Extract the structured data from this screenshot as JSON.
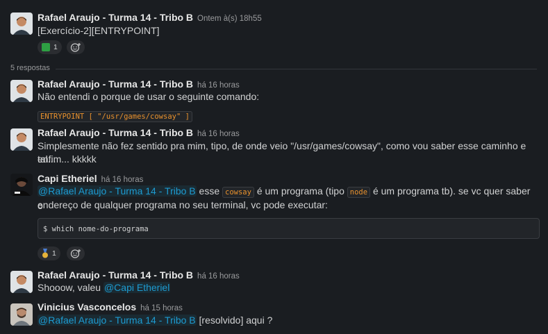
{
  "messages": [
    {
      "name": "Rafael Araujo - Turma 14 - Tribo B",
      "time": "Ontem à(s) 18h55",
      "text": "[Exercício-2][ENTRYPOINT]",
      "reaction_count": "1"
    },
    {
      "name": "Rafael Araujo - Turma 14 - Tribo B",
      "time": "há 16 horas",
      "text": "Não entendi o porque de usar o seguinte comando:",
      "code": "ENTRYPOINT [ \"/usr/games/cowsay\" ]"
    },
    {
      "name": "Rafael Araujo - Turma 14 - Tribo B",
      "time": "há 16 horas",
      "line1": "Simplesmente não fez sentido pra mim, tipo, de onde veio \"/usr/games/cowsay\", como vou saber esse caminho e tal...",
      "line2": "enfim... kkkkk"
    },
    {
      "name": "Capi Etheriel",
      "time": "há 16 horas",
      "mention": "@Rafael Araujo - Turma 14 - Tribo B",
      "t1": " esse ",
      "code1": "cowsay",
      "t2": " é um programa (tipo ",
      "code2": "node",
      "t3": " é um programa tb). se vc quer saber o",
      "line2": "endereço de qualquer programa no seu terminal, vc pode executar:",
      "pre": "$ which nome-do-programa",
      "reaction_count": "1"
    },
    {
      "name": "Rafael Araujo - Turma 14 - Tribo B",
      "time": "há 16 horas",
      "text": "Shooow, valeu ",
      "mention": "@Capi Etheriel"
    },
    {
      "name": "Vinicius Vasconcelos",
      "time": "há 15 horas",
      "mention": "@Rafael Araujo - Turma 14 - Tribo B",
      "text": " [resolvido] aqui ?"
    }
  ],
  "thread": {
    "replies_label": "5 respostas"
  },
  "colors": {
    "background": "#1a1d21",
    "mention": "#1d9bd1",
    "code": "#e8912d"
  }
}
